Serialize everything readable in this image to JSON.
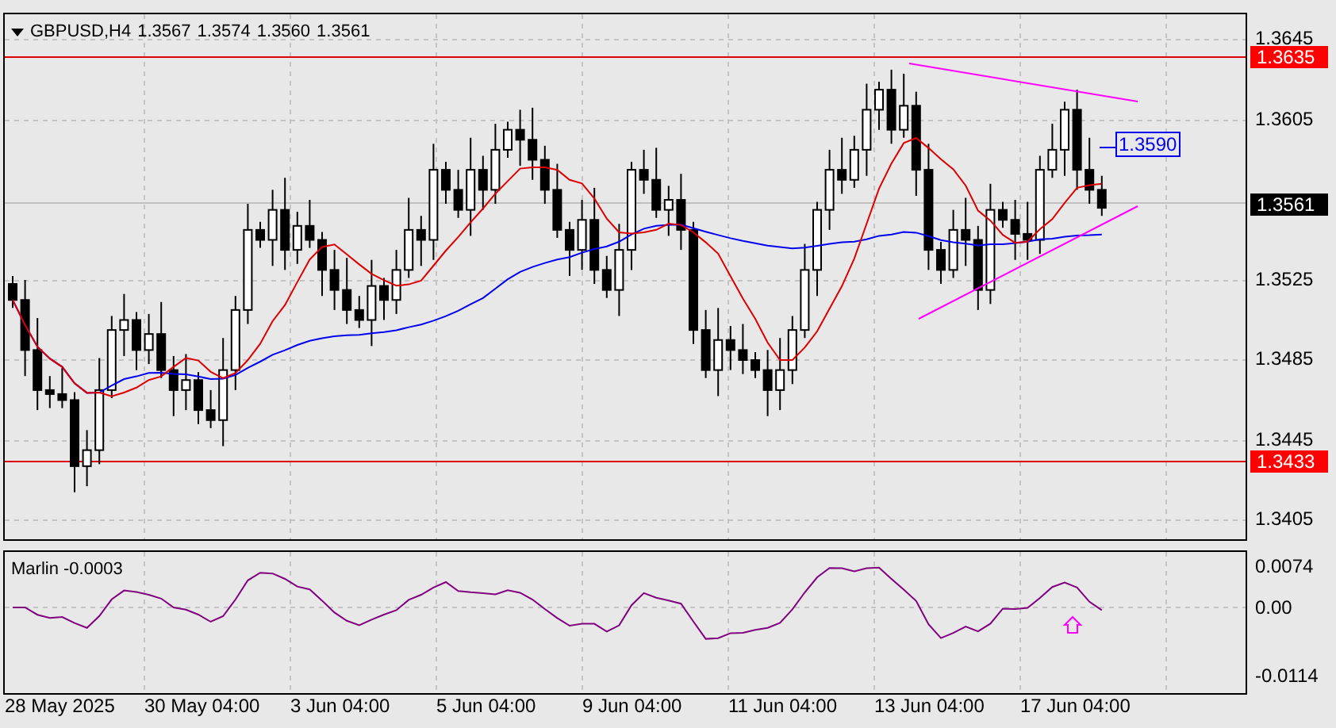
{
  "header": {
    "symbol": "GBPUSD,H4",
    "ohlc": [
      "1.3567",
      "1.3574",
      "1.3560",
      "1.3561"
    ]
  },
  "price_axis": {
    "ticks": [
      "1.3645",
      "1.3605",
      "1.3525",
      "1.3485",
      "1.3445",
      "1.3405"
    ]
  },
  "price_labels": [
    {
      "text": "1.3635",
      "kind": "level"
    },
    {
      "text": "1.3561",
      "kind": "current"
    },
    {
      "text": "1.3433",
      "kind": "level"
    }
  ],
  "ma_label": "1.3590",
  "indicator": {
    "label": "Marlin -0.0003",
    "ticks": [
      "0.0074",
      "0.00",
      "-0.0114"
    ]
  },
  "time_axis": [
    "28 May 2025",
    "30 May 04:00",
    "3 Jun 04:00",
    "5 Jun 04:00",
    "9 Jun 04:00",
    "11 Jun 04:00",
    "13 Jun 04:00",
    "17 Jun 04:00"
  ]
}
